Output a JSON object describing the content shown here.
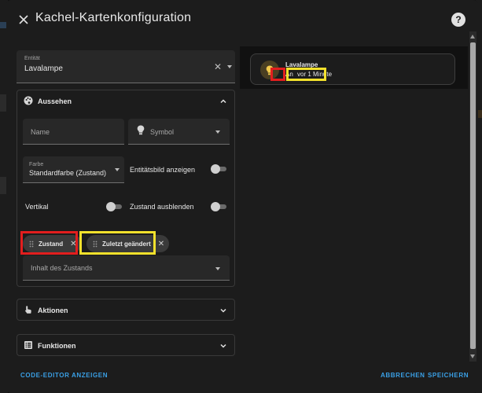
{
  "dialog": {
    "title": "Kachel-Kartenkonfiguration",
    "help_label": "?"
  },
  "entity": {
    "label": "Entität",
    "value": "Lavalampe"
  },
  "appearance": {
    "title": "Aussehen",
    "name_placeholder": "Name",
    "symbol_placeholder": "Symbol",
    "color_label": "Farbe",
    "color_value": "Standardfarbe (Zustand)",
    "entity_image_label": "Entitätsbild anzeigen",
    "vertical_label": "Vertikal",
    "hide_state_label": "Zustand ausblenden",
    "state_content_placeholder": "Inhalt des Zustands",
    "chips": [
      {
        "label": "Zustand"
      },
      {
        "label": "Zuletzt geändert"
      }
    ]
  },
  "actions": {
    "title": "Aktionen"
  },
  "features": {
    "title": "Funktionen"
  },
  "preview": {
    "name": "Lavalampe",
    "state": "An",
    "changed": "vor 1 Minute"
  },
  "footer": {
    "code_editor": "CODE-EDITOR ANZEIGEN",
    "cancel": "ABBRECHEN",
    "save": "SPEICHERN"
  },
  "colors": {
    "accent": "#3aa0e6",
    "highlight_red": "#e21e1e",
    "highlight_yellow": "#f3e12c",
    "bulb": "#f2c94c"
  }
}
